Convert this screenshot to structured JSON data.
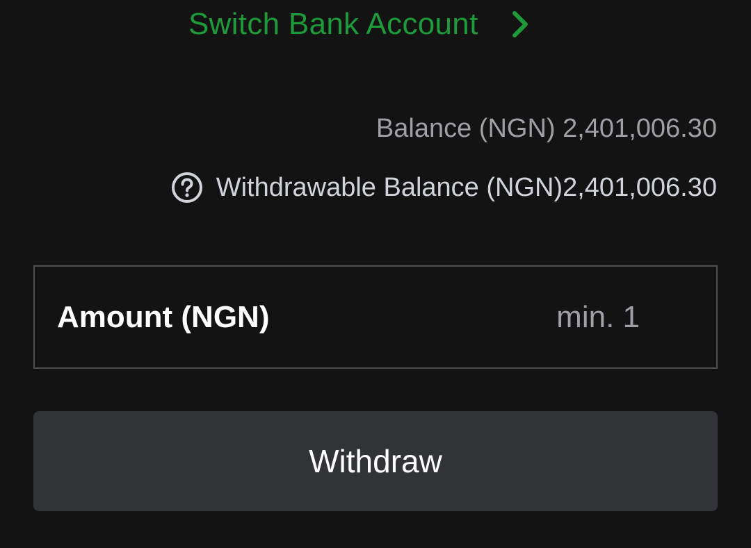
{
  "switch_account": {
    "label": "Switch Bank Account",
    "icon": "chevron-right-icon",
    "color": "#1f9a3a"
  },
  "balance": {
    "label": "Balance (NGN)",
    "value": "2,401,006.30"
  },
  "withdrawable_balance": {
    "icon": "help-icon",
    "label": "Withdrawable Balance (NGN)",
    "value": "2,401,006.30"
  },
  "amount_field": {
    "label": "Amount (NGN)",
    "value": "",
    "placeholder": "min. 1"
  },
  "withdraw_button": {
    "label": "Withdraw"
  },
  "colors": {
    "background": "#131314",
    "accent": "#1f9a3a",
    "button_bg": "#323337"
  }
}
